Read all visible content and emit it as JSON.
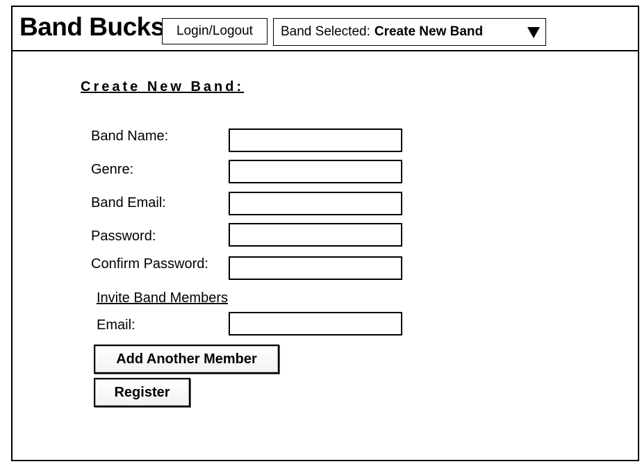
{
  "header": {
    "app_title": "Band Bucks",
    "login_label": "Login/Logout",
    "band_select": {
      "prefix": "Band Selected:",
      "value": "Create New Band"
    }
  },
  "form": {
    "title": "Create New Band:",
    "fields": [
      {
        "label": "Band Name:",
        "value": ""
      },
      {
        "label": "Genre:",
        "value": ""
      },
      {
        "label": "Band Email:",
        "value": ""
      },
      {
        "label": "Password:",
        "value": ""
      },
      {
        "label": "Confirm Password:",
        "value": ""
      }
    ],
    "invite": {
      "heading": "Invite Band Members",
      "email_label": "Email:",
      "email_value": ""
    },
    "add_member_label": "Add Another Member",
    "register_label": "Register"
  }
}
